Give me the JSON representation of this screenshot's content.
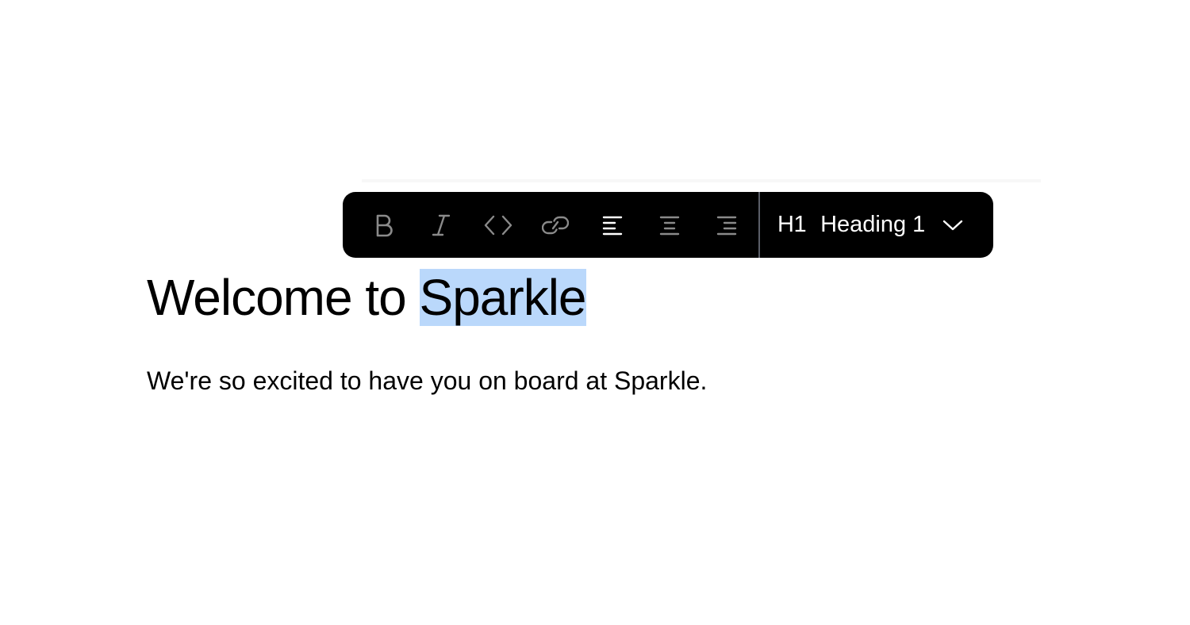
{
  "toolbar": {
    "buttons": [
      {
        "name": "bold",
        "icon": "bold-icon",
        "active": false
      },
      {
        "name": "italic",
        "icon": "italic-icon",
        "active": false
      },
      {
        "name": "code",
        "icon": "code-icon",
        "active": false
      },
      {
        "name": "link",
        "icon": "link-icon",
        "active": false
      },
      {
        "name": "align-left",
        "icon": "align-left-icon",
        "active": true
      },
      {
        "name": "align-center",
        "icon": "align-center-icon",
        "active": false
      },
      {
        "name": "align-right",
        "icon": "align-right-icon",
        "active": false
      }
    ],
    "block_type": {
      "short": "H1",
      "label": "Heading 1"
    },
    "colors": {
      "background": "#000000",
      "icon_inactive": "#8a8a8a",
      "icon_active": "#ffffff",
      "divider": "#5a5e68"
    }
  },
  "document": {
    "heading_before_selection": "Welcome to ",
    "heading_selected": "Sparkle",
    "paragraph": "We're so excited to have you on board at Sparkle.",
    "selection_color": "#bad8fb"
  }
}
